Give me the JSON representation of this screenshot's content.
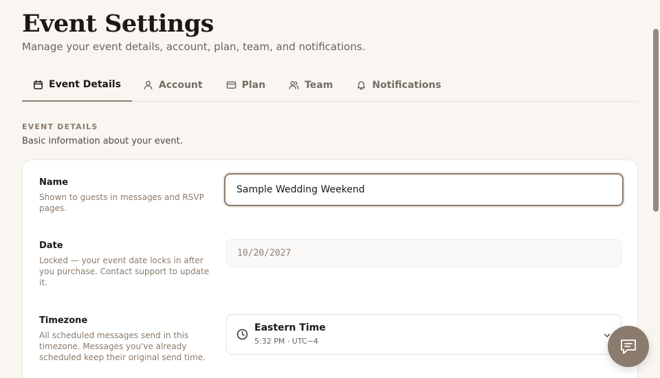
{
  "header": {
    "title": "Event Settings",
    "subtitle": "Manage your event details, account, plan, team, and notifications."
  },
  "tabs": [
    {
      "label": "Event Details",
      "icon": "calendar-icon",
      "active": true
    },
    {
      "label": "Account",
      "icon": "user-icon",
      "active": false
    },
    {
      "label": "Plan",
      "icon": "credit-card-icon",
      "active": false
    },
    {
      "label": "Team",
      "icon": "users-icon",
      "active": false
    },
    {
      "label": "Notifications",
      "icon": "bell-icon",
      "active": false
    }
  ],
  "section": {
    "eyebrow": "EVENT DETAILS",
    "description": "Basic information about your event."
  },
  "fields": {
    "name": {
      "label": "Name",
      "help": "Shown to guests in messages and RSVP pages.",
      "value": "Sample Wedding Weekend"
    },
    "date": {
      "label": "Date",
      "help": "Locked — your event date locks in after you purchase. Contact support to update it.",
      "value": "10/20/2027"
    },
    "timezone": {
      "label": "Timezone",
      "help": "All scheduled messages send in this timezone. Messages you've already scheduled keep their original send time.",
      "value": "Eastern Time",
      "detail": "5:32 PM · UTC−4"
    }
  },
  "colors": {
    "background": "#f9f6f2",
    "accent": "#8b7b6d",
    "text": "#1c1815",
    "muted": "#8a7a6c"
  },
  "icons": {
    "chat_button": "chat-bubble-icon",
    "timezone": "clock-icon",
    "dropdown": "chevron-down-icon"
  }
}
